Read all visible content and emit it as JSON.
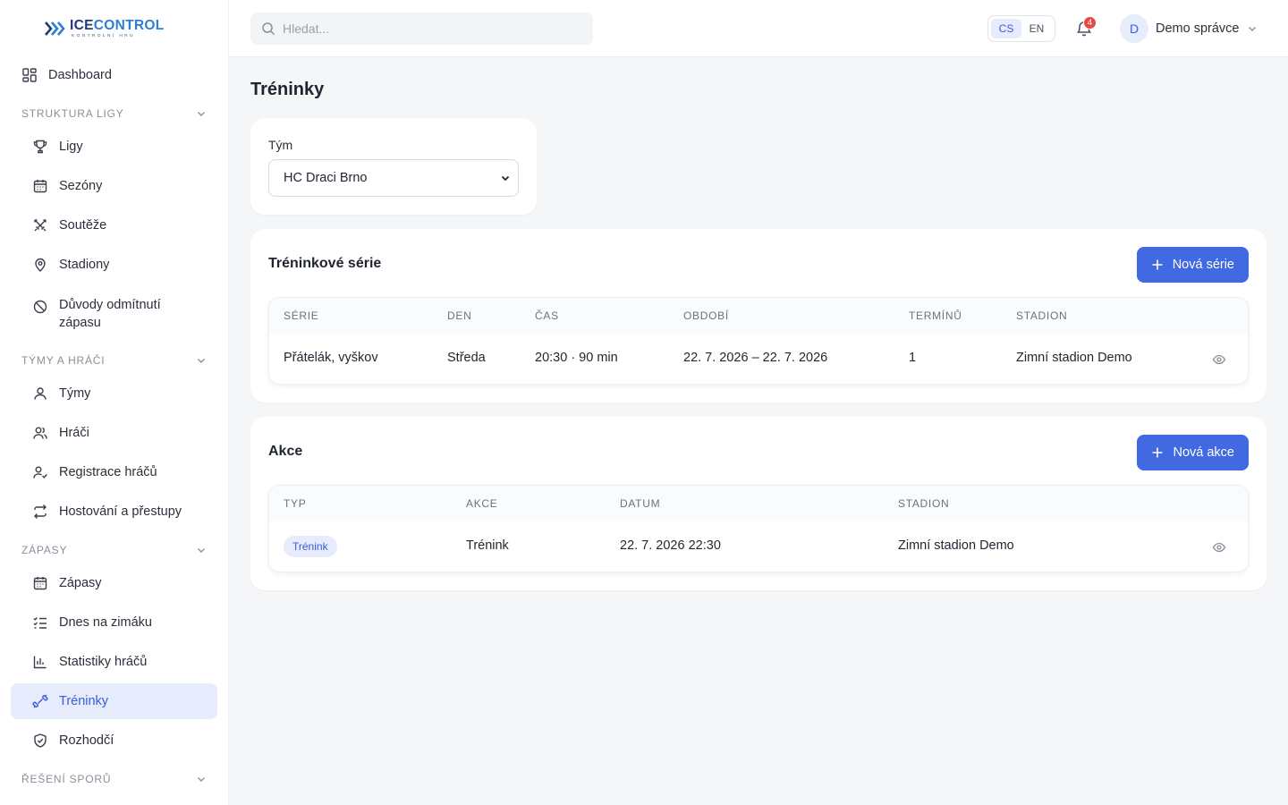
{
  "logo": {
    "brand_part1": "ICE",
    "brand_part2": "CONTROL",
    "tagline": "KONTROLNÍ HRU"
  },
  "sidebar": {
    "dashboard": "Dashboard",
    "sections": [
      {
        "title": "STRUKTURA LIGY",
        "items": [
          "Ligy",
          "Sezóny",
          "Soutěže",
          "Stadiony",
          "Důvody odmítnutí zápasu"
        ]
      },
      {
        "title": "TÝMY A HRÁČI",
        "items": [
          "Týmy",
          "Hráči",
          "Registrace hráčů",
          "Hostování a přestupy"
        ]
      },
      {
        "title": "ZÁPASY",
        "items": [
          "Zápasy",
          "Dnes na zimáku",
          "Statistiky hráčů",
          "Tréninky",
          "Rozhodčí"
        ]
      },
      {
        "title": "ŘEŠENÍ SPORŮ",
        "items": []
      }
    ],
    "active_item": "Tréninky"
  },
  "topbar": {
    "search_placeholder": "Hledat...",
    "languages": [
      "CS",
      "EN"
    ],
    "active_language": "CS",
    "notification_count": "4",
    "user_initial": "D",
    "user_name": "Demo správce"
  },
  "page": {
    "title": "Tréninky",
    "filter": {
      "label": "Tým",
      "value": "HC Draci Brno"
    }
  },
  "series": {
    "title": "Tréninkové série",
    "button": "Nová série",
    "columns": [
      "SÉRIE",
      "DEN",
      "ČAS",
      "OBDOBÍ",
      "TERMÍNŮ",
      "STADION"
    ],
    "rows": [
      {
        "name": "Přátelák, vyškov",
        "day": "Středa",
        "time": "20:30 · 90 min",
        "period": "22. 7. 2026 – 22. 7. 2026",
        "count": "1",
        "stadium": "Zimní stadion Demo"
      }
    ]
  },
  "events": {
    "title": "Akce",
    "button": "Nová akce",
    "columns": [
      "TYP",
      "AKCE",
      "DATUM",
      "STADION"
    ],
    "rows": [
      {
        "type": "Trénink",
        "event": "Trénink",
        "date": "22. 7. 2026 22:30",
        "stadium": "Zimní stadion Demo"
      }
    ]
  },
  "colors": {
    "accent": "#4169e1",
    "active_bg": "#e6ecfb",
    "active_text": "#3b5bdb",
    "badge": "#e74848"
  }
}
